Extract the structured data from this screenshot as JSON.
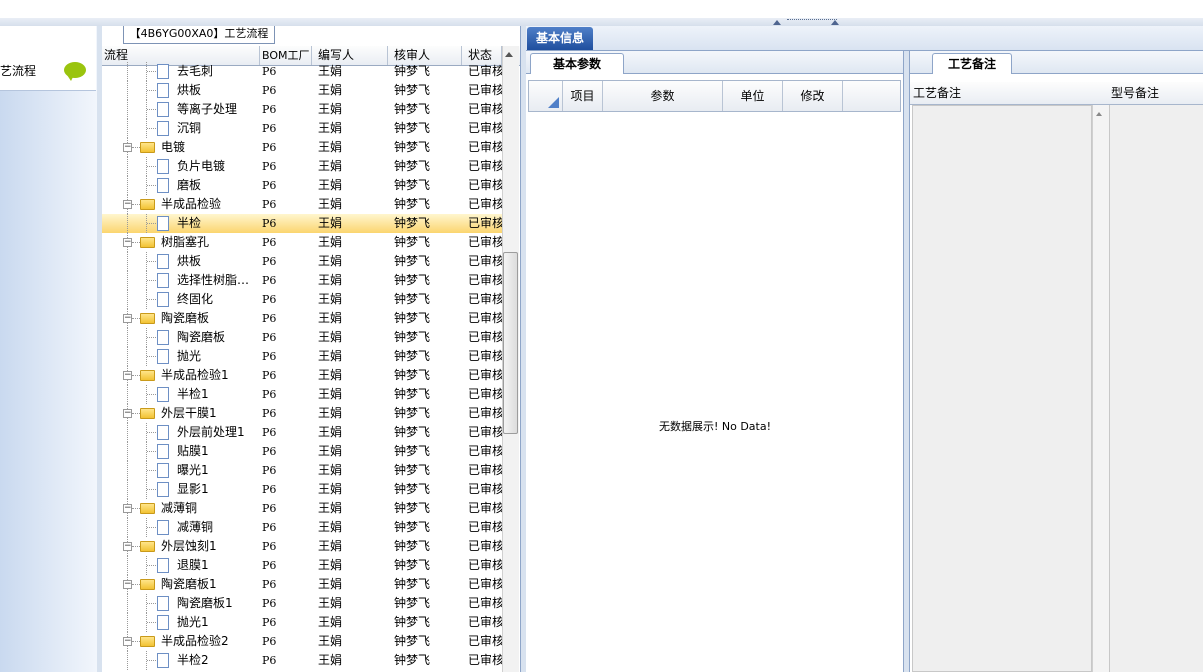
{
  "left_nav": {
    "item_label": "工艺流程"
  },
  "tree": {
    "title": "【4B6YG00XA0】工艺流程",
    "columns": [
      "流程",
      "BOM工厂",
      "编写人",
      "核审人",
      "状态"
    ],
    "rows": [
      {
        "name": "去毛刺",
        "type": "doc",
        "level": 2,
        "bom": "P6",
        "writer": "王娟",
        "reviewer": "钟梦飞",
        "status": "已审核"
      },
      {
        "name": "烘板",
        "type": "doc",
        "level": 2,
        "bom": "P6",
        "writer": "王娟",
        "reviewer": "钟梦飞",
        "status": "已审核"
      },
      {
        "name": "等离子处理",
        "type": "doc",
        "level": 2,
        "bom": "P6",
        "writer": "王娟",
        "reviewer": "钟梦飞",
        "status": "已审核"
      },
      {
        "name": "沉铜",
        "type": "doc",
        "level": 2,
        "bom": "P6",
        "writer": "王娟",
        "reviewer": "钟梦飞",
        "status": "已审核"
      },
      {
        "name": "电镀",
        "type": "folder",
        "level": 1,
        "bom": "P6",
        "writer": "王娟",
        "reviewer": "钟梦飞",
        "status": "已审核"
      },
      {
        "name": "负片电镀",
        "type": "doc",
        "level": 2,
        "bom": "P6",
        "writer": "王娟",
        "reviewer": "钟梦飞",
        "status": "已审核"
      },
      {
        "name": "磨板",
        "type": "doc",
        "level": 2,
        "bom": "P6",
        "writer": "王娟",
        "reviewer": "钟梦飞",
        "status": "已审核"
      },
      {
        "name": "半成品检验",
        "type": "folder",
        "level": 1,
        "bom": "P6",
        "writer": "王娟",
        "reviewer": "钟梦飞",
        "status": "已审核"
      },
      {
        "name": "半检",
        "type": "doc",
        "level": 2,
        "bom": "P6",
        "writer": "王娟",
        "reviewer": "钟梦飞",
        "status": "已审核",
        "selected": true
      },
      {
        "name": "树脂塞孔",
        "type": "folder",
        "level": 1,
        "bom": "P6",
        "writer": "王娟",
        "reviewer": "钟梦飞",
        "status": "已审核"
      },
      {
        "name": "烘板",
        "type": "doc",
        "level": 2,
        "bom": "P6",
        "writer": "王娟",
        "reviewer": "钟梦飞",
        "status": "已审核"
      },
      {
        "name": "选择性树脂…",
        "type": "doc",
        "level": 2,
        "bom": "P6",
        "writer": "王娟",
        "reviewer": "钟梦飞",
        "status": "已审核"
      },
      {
        "name": "终固化",
        "type": "doc",
        "level": 2,
        "bom": "P6",
        "writer": "王娟",
        "reviewer": "钟梦飞",
        "status": "已审核"
      },
      {
        "name": "陶瓷磨板",
        "type": "folder",
        "level": 1,
        "bom": "P6",
        "writer": "王娟",
        "reviewer": "钟梦飞",
        "status": "已审核"
      },
      {
        "name": "陶瓷磨板",
        "type": "doc",
        "level": 2,
        "bom": "P6",
        "writer": "王娟",
        "reviewer": "钟梦飞",
        "status": "已审核"
      },
      {
        "name": "抛光",
        "type": "doc",
        "level": 2,
        "bom": "P6",
        "writer": "王娟",
        "reviewer": "钟梦飞",
        "status": "已审核"
      },
      {
        "name": "半成品检验1",
        "type": "folder",
        "level": 1,
        "bom": "P6",
        "writer": "王娟",
        "reviewer": "钟梦飞",
        "status": "已审核"
      },
      {
        "name": "半检1",
        "type": "doc",
        "level": 2,
        "bom": "P6",
        "writer": "王娟",
        "reviewer": "钟梦飞",
        "status": "已审核"
      },
      {
        "name": "外层干膜1",
        "type": "folder",
        "level": 1,
        "bom": "P6",
        "writer": "王娟",
        "reviewer": "钟梦飞",
        "status": "已审核"
      },
      {
        "name": "外层前处理1",
        "type": "doc",
        "level": 2,
        "bom": "P6",
        "writer": "王娟",
        "reviewer": "钟梦飞",
        "status": "已审核"
      },
      {
        "name": "贴膜1",
        "type": "doc",
        "level": 2,
        "bom": "P6",
        "writer": "王娟",
        "reviewer": "钟梦飞",
        "status": "已审核"
      },
      {
        "name": "曝光1",
        "type": "doc",
        "level": 2,
        "bom": "P6",
        "writer": "王娟",
        "reviewer": "钟梦飞",
        "status": "已审核"
      },
      {
        "name": "显影1",
        "type": "doc",
        "level": 2,
        "bom": "P6",
        "writer": "王娟",
        "reviewer": "钟梦飞",
        "status": "已审核"
      },
      {
        "name": "减薄铜",
        "type": "folder",
        "level": 1,
        "bom": "P6",
        "writer": "王娟",
        "reviewer": "钟梦飞",
        "status": "已审核"
      },
      {
        "name": "减薄铜",
        "type": "doc",
        "level": 2,
        "bom": "P6",
        "writer": "王娟",
        "reviewer": "钟梦飞",
        "status": "已审核"
      },
      {
        "name": "外层蚀刻1",
        "type": "folder",
        "level": 1,
        "bom": "P6",
        "writer": "王娟",
        "reviewer": "钟梦飞",
        "status": "已审核"
      },
      {
        "name": "退膜1",
        "type": "doc",
        "level": 2,
        "bom": "P6",
        "writer": "王娟",
        "reviewer": "钟梦飞",
        "status": "已审核"
      },
      {
        "name": "陶瓷磨板1",
        "type": "folder",
        "level": 1,
        "bom": "P6",
        "writer": "王娟",
        "reviewer": "钟梦飞",
        "status": "已审核"
      },
      {
        "name": "陶瓷磨板1",
        "type": "doc",
        "level": 2,
        "bom": "P6",
        "writer": "王娟",
        "reviewer": "钟梦飞",
        "status": "已审核"
      },
      {
        "name": "抛光1",
        "type": "doc",
        "level": 2,
        "bom": "P6",
        "writer": "王娟",
        "reviewer": "钟梦飞",
        "status": "已审核"
      },
      {
        "name": "半成品检验2",
        "type": "folder",
        "level": 1,
        "bom": "P6",
        "writer": "王娟",
        "reviewer": "钟梦飞",
        "status": "已审核"
      },
      {
        "name": "半检2",
        "type": "doc",
        "level": 2,
        "bom": "P6",
        "writer": "王娟",
        "reviewer": "钟梦飞",
        "status": "已审核"
      }
    ]
  },
  "middle": {
    "main_tab": "基本信息",
    "sub_tab": "基本参数",
    "columns": [
      "项目",
      "参数",
      "单位",
      "修改"
    ],
    "empty_text": "无数据展示! No Data!"
  },
  "right": {
    "tab": "工艺备注",
    "columns": [
      "工艺备注",
      "型号备注"
    ]
  },
  "colors": {
    "accent": "#1f4f9e",
    "selection": "#fbd56f",
    "folder": "#f2c233"
  }
}
